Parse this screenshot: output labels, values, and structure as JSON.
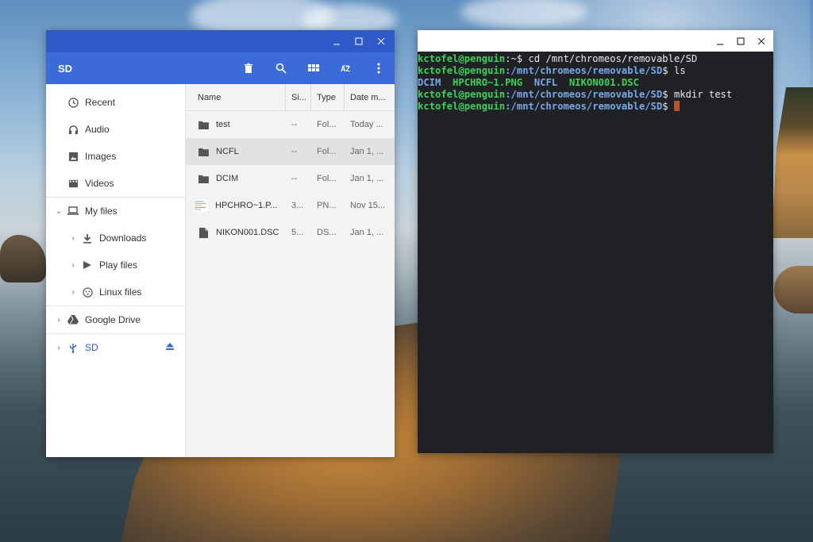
{
  "files_app": {
    "window_controls": {
      "minimize": "_",
      "maximize": "☐",
      "close": "✕"
    },
    "title": "SD",
    "toolbar": [
      {
        "name": "delete-icon",
        "glyph": "🗑"
      },
      {
        "name": "search-icon",
        "glyph": "⚲"
      },
      {
        "name": "grid-view-icon",
        "glyph": "▦"
      },
      {
        "name": "sort-icon",
        "glyph": "AZ"
      },
      {
        "name": "more-vert-icon",
        "glyph": "⋮"
      }
    ],
    "sidebar": {
      "items": [
        {
          "label": "Recent",
          "icon": "clock-icon"
        },
        {
          "label": "Audio",
          "icon": "audio-icon"
        },
        {
          "label": "Images",
          "icon": "image-icon"
        },
        {
          "label": "Videos",
          "icon": "video-icon"
        },
        {
          "label": "My files",
          "icon": "laptop-icon"
        },
        {
          "label": "Downloads",
          "icon": "download-icon"
        },
        {
          "label": "Play files",
          "icon": "play-icon"
        },
        {
          "label": "Linux files",
          "icon": "penguin-icon"
        },
        {
          "label": "Google Drive",
          "icon": "drive-icon"
        },
        {
          "label": "SD",
          "icon": "usb-icon"
        }
      ]
    },
    "columns": {
      "name": "Name",
      "size": "Si...",
      "type": "Type",
      "date": "Date m..."
    },
    "rows": [
      {
        "name": "test",
        "size": "--",
        "type": "Fol...",
        "date": "Today ...",
        "icon": "folder-icon"
      },
      {
        "name": "NCFL",
        "size": "--",
        "type": "Fol...",
        "date": "Jan 1, ...",
        "icon": "folder-icon",
        "selected": true
      },
      {
        "name": "DCIM",
        "size": "--",
        "type": "Fol...",
        "date": "Jan 1, ...",
        "icon": "folder-icon"
      },
      {
        "name": "HPCHRO~1.P...",
        "size": "3...",
        "type": "PN...",
        "date": "Nov 15...",
        "icon": "image-thumb-icon"
      },
      {
        "name": "NIKON001.DSC",
        "size": "5...",
        "type": "DS...",
        "date": "Jan 1, ...",
        "icon": "file-icon"
      }
    ]
  },
  "terminal": {
    "window_controls": {
      "minimize": "_",
      "maximize": "☐",
      "close": "✕"
    },
    "lines": {
      "l1_user": "kctofel@penguin",
      "l1_sep": ":~$ ",
      "l1_cmd": "cd /mnt/chromeos/removable/SD",
      "l2_user": "kctofel@penguin",
      "l2_path": ":/mnt/chromeos/removable/SD",
      "l2_cmd": "$ ls",
      "l3_dcim": "DCIM",
      "l3_png": "HPCHRO~1.PNG",
      "l3_ncfl": "NCFL",
      "l3_nikon": "NIKON001.DSC",
      "l4_user": "kctofel@penguin",
      "l4_path": ":/mnt/chromeos/removable/SD",
      "l4_cmd": "$ mkdir test",
      "l5_user": "kctofel@penguin",
      "l5_path": ":/mnt/chromeos/removable/SD",
      "l5_cmd": "$ "
    }
  }
}
